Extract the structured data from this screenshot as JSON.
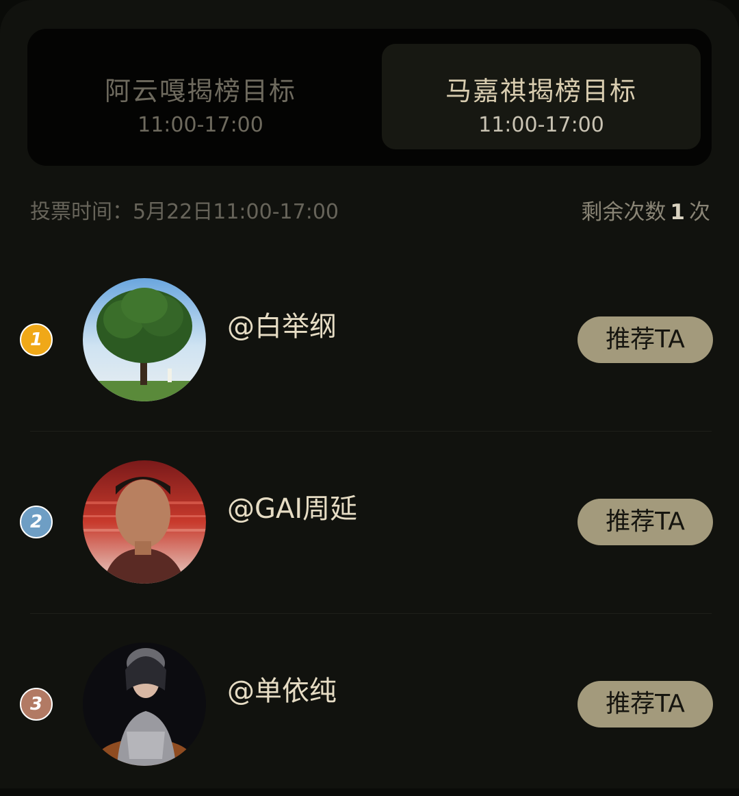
{
  "tabs": [
    {
      "title": "阿云嘎揭榜目标",
      "time": "11:00-17:00",
      "active": false
    },
    {
      "title": "马嘉祺揭榜目标",
      "time": "11:00-17:00",
      "active": true
    }
  ],
  "vote_info": "投票时间：5月22日11:00-17:00",
  "remaining": {
    "prefix": "剩余次数",
    "count": "1",
    "suffix": "次"
  },
  "candidates": [
    {
      "rank": "1",
      "name": "@白举纲",
      "button": "推荐TA",
      "rank_color": "#f0a818"
    },
    {
      "rank": "2",
      "name": "@GAI周延",
      "button": "推荐TA",
      "rank_color": "#6e9ec4"
    },
    {
      "rank": "3",
      "name": "@单依纯",
      "button": "推荐TA",
      "rank_color": "#b27a64"
    }
  ],
  "colors": {
    "background": "#11120e",
    "accent_button": "#a39a7c",
    "name_text": "#e6dcc4"
  }
}
